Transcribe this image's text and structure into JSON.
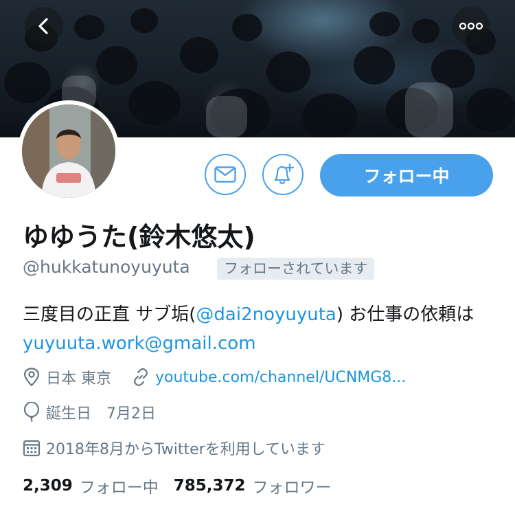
{
  "profile": {
    "display_name": "ゆゆうた(鈴木悠太)",
    "handle": "@hukkatunoyuyuta",
    "follows_you_badge": "フォローされています",
    "bio": {
      "part1": "三度目の正直 サブ垢(",
      "mention": "@dai2noyuyuta",
      "part2": ") お仕事の依頼は",
      "email": "yuyuuta.work@gmail.com"
    },
    "location": "日本 東京",
    "url": "youtube.com/channel/UCNMG8...",
    "birthday": "誕生日　7月2日",
    "joined": "2018年8月からTwitterを利用しています"
  },
  "actions": {
    "follow_label": "フォロー中"
  },
  "stats": {
    "following_count": "2,309",
    "following_label": "フォロー中",
    "followers_count": "785,372",
    "followers_label": "フォロワー"
  },
  "icons": {
    "back": "back-chevron-icon",
    "more": "more-options-icon",
    "mail": "mail-icon",
    "notify": "bell-plus-icon",
    "location": "location-pin-icon",
    "link": "link-icon",
    "birthday": "balloon-icon",
    "calendar": "calendar-icon"
  },
  "colors": {
    "accent": "#4aa1eb",
    "link": "#1b95e0",
    "secondary_text": "#657786",
    "primary_text": "#14171a",
    "badge_bg": "#e6ecf0"
  }
}
